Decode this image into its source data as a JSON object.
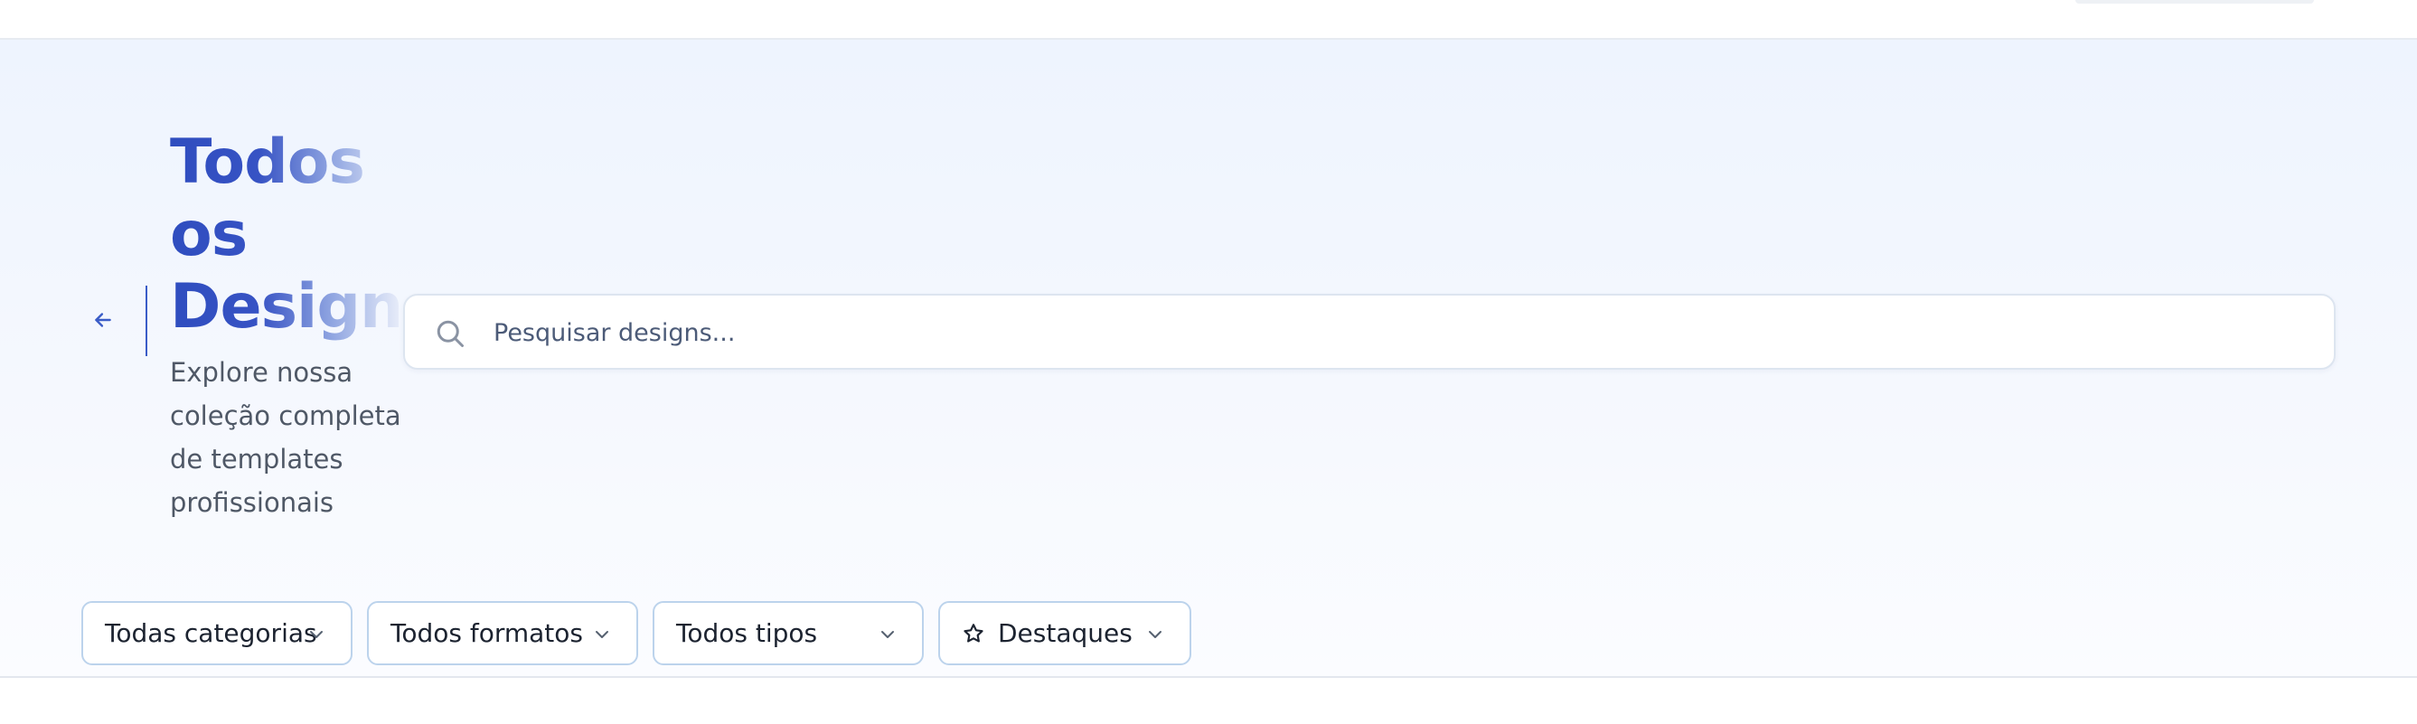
{
  "header": {
    "title": "Todos os Designs",
    "subtitle": "Explore nossa coleção completa de templates profissionais",
    "back_icon": "arrow-left-icon"
  },
  "search": {
    "placeholder": "Pesquisar designs...",
    "value": "",
    "icon": "search-icon"
  },
  "filters": {
    "category": "Todas categorias",
    "format": "Todos formatos",
    "type": "Todos tipos",
    "featured": "Destaques"
  },
  "colors": {
    "accent": "#2f4dbf",
    "filter_border": "#bcd3ec",
    "hero_background": "#eef4fe"
  }
}
